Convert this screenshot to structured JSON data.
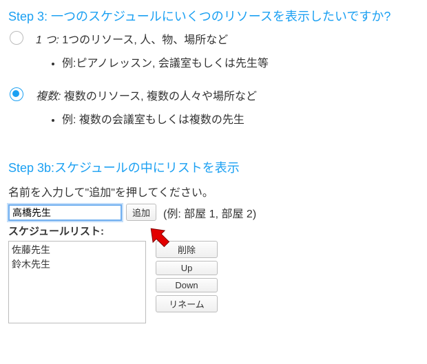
{
  "step3": {
    "title": "Step 3: 一つのスケジュールにいくつのリソースを表示したいですか?",
    "opt1": {
      "prefix": "1 つ:",
      "text": " 1つのリソース, 人、物、場所など",
      "example": "例:ピアノレッスン, 会議室もしくは先生等"
    },
    "opt2": {
      "prefix": "複数:",
      "text": " 複数のリソース, 複数の人々や場所など",
      "example": "例: 複数の会議室もしくは複数の先生"
    }
  },
  "step3b": {
    "title": "Step 3b:スケジュールの中にリストを表示",
    "instruction": "名前を入力して\"追加\"を押してください。",
    "input_value": "高橋先生",
    "add_label": "追加",
    "hint": "(例: 部屋 1, 部屋 2)",
    "list_label": "スケジュールリスト:",
    "items": [
      "佐藤先生",
      "鈴木先生"
    ],
    "buttons": {
      "delete": "削除",
      "up": "Up",
      "down": "Down",
      "rename": "リネーム"
    }
  }
}
